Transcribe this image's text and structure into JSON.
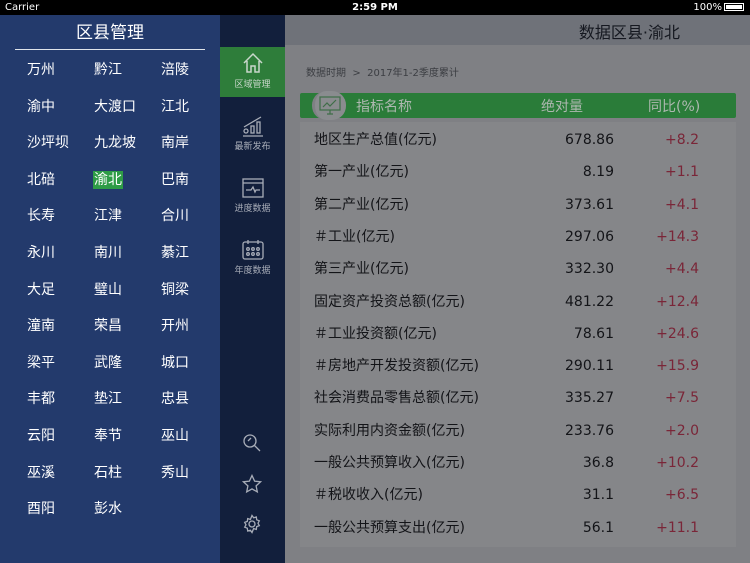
{
  "status": {
    "carrier": "Carrier",
    "time": "2:59 PM",
    "battery": "100%"
  },
  "left": {
    "title": "区县管理",
    "districts": [
      "万州",
      "黔江",
      "涪陵",
      "渝中",
      "大渡口",
      "江北",
      "沙坪坝",
      "九龙坡",
      "南岸",
      "北碚",
      "渝北",
      "巴南",
      "长寿",
      "江津",
      "合川",
      "永川",
      "南川",
      "綦江",
      "大足",
      "璧山",
      "铜梁",
      "潼南",
      "荣昌",
      "开州",
      "梁平",
      "武隆",
      "城口",
      "丰都",
      "垫江",
      "忠县",
      "云阳",
      "奉节",
      "巫山",
      "巫溪",
      "石柱",
      "秀山",
      "酉阳",
      "彭水"
    ],
    "selected": "渝北"
  },
  "nav": {
    "items": [
      {
        "label": "区域管理",
        "icon": "home-icon"
      },
      {
        "label": "最新发布",
        "icon": "growth-chart-icon"
      },
      {
        "label": "进度数据",
        "icon": "monitor-pulse-icon"
      },
      {
        "label": "年度数据",
        "icon": "calendar-icon"
      }
    ],
    "bottom": [
      "search-icon",
      "star-icon",
      "gear-icon"
    ]
  },
  "main": {
    "title": "数据区县·渝北",
    "crumb_label": "数据时期",
    "crumb_sep": ">",
    "crumb_value": "2017年1-2季度累计",
    "headers": {
      "name": "指标名称",
      "value": "绝对量",
      "pct": "同比(%)"
    },
    "rows": [
      {
        "name": "地区生产总值(亿元)",
        "value": "678.86",
        "pct": "+8.2"
      },
      {
        "name": "第一产业(亿元)",
        "value": "8.19",
        "pct": "+1.1"
      },
      {
        "name": "第二产业(亿元)",
        "value": "373.61",
        "pct": "+4.1"
      },
      {
        "name": "＃工业(亿元)",
        "value": "297.06",
        "pct": "+14.3"
      },
      {
        "name": "第三产业(亿元)",
        "value": "332.30",
        "pct": "+4.4"
      },
      {
        "name": "固定资产投资总额(亿元)",
        "value": "481.22",
        "pct": "+12.4"
      },
      {
        "name": "＃工业投资额(亿元)",
        "value": "78.61",
        "pct": "+24.6"
      },
      {
        "name": "＃房地产开发投资额(亿元)",
        "value": "290.11",
        "pct": "+15.9"
      },
      {
        "name": "社会消费品零售总额(亿元)",
        "value": "335.27",
        "pct": "+7.5"
      },
      {
        "name": "实际利用内资金额(亿元)",
        "value": "233.76",
        "pct": "+2.0"
      },
      {
        "name": "一般公共预算收入(亿元)",
        "value": "36.8",
        "pct": "+10.2"
      },
      {
        "name": "＃税收收入(亿元)",
        "value": "31.1",
        "pct": "+6.5"
      },
      {
        "name": "一般公共预算支出(亿元)",
        "value": "56.1",
        "pct": "+11.1"
      }
    ]
  }
}
